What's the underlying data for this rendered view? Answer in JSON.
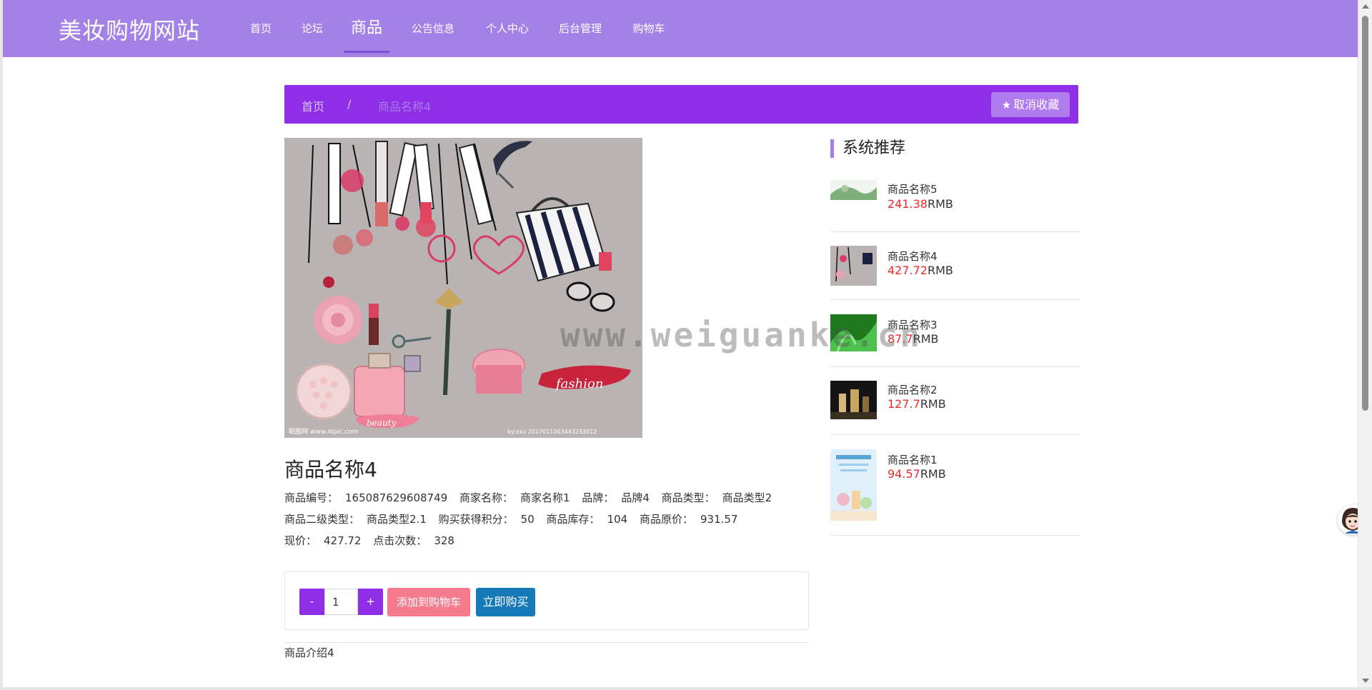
{
  "site": {
    "brand": "美妆购物网站"
  },
  "nav": {
    "items": [
      {
        "label": "首页"
      },
      {
        "label": "论坛"
      },
      {
        "label": "商品"
      },
      {
        "label": "公告信息"
      },
      {
        "label": "个人中心"
      },
      {
        "label": "后台管理"
      },
      {
        "label": "购物车"
      }
    ],
    "active": "商品"
  },
  "breadcrumb": {
    "home": "首页",
    "separator": "/",
    "current": "商品名称4",
    "favorite_button": "取消收藏",
    "favorite_icon": "star-icon"
  },
  "product": {
    "title": "商品名称4",
    "info": [
      [
        {
          "label": "商品编号：",
          "value": "165087629608749"
        },
        {
          "label": "商家名称：",
          "value": "商家名称1"
        },
        {
          "label": "品牌：",
          "value": "品牌4"
        },
        {
          "label": "商品类型：",
          "value": "商品类型2"
        }
      ],
      [
        {
          "label": "商品二级类型：",
          "value": "商品类型2.1"
        },
        {
          "label": "购买获得积分：",
          "value": "50"
        },
        {
          "label": "商品库存：",
          "value": "104"
        },
        {
          "label": "商品原价：",
          "value": "931.57"
        }
      ],
      [
        {
          "label": "现价：",
          "value": "427.72"
        },
        {
          "label": "点击次数：",
          "value": "328"
        }
      ]
    ],
    "image_watermark_left": "昵图网 www.nipic.com",
    "image_watermark_right": "by:xxx 2017011003443233012",
    "image_brand_text": "fashion",
    "image_beauty_text": "beauty",
    "quantity": "1",
    "minus_label": "-",
    "plus_label": "+",
    "add_to_cart": "添加到购物车",
    "buy_now": "立即购买",
    "intro": "商品介绍4"
  },
  "recommend": {
    "title": "系统推荐",
    "currency": "RMB",
    "items": [
      {
        "name": "商品名称5",
        "price": "241.38"
      },
      {
        "name": "商品名称4",
        "price": "427.72"
      },
      {
        "name": "商品名称3",
        "price": "87.7"
      },
      {
        "name": "商品名称2",
        "price": "127.7"
      },
      {
        "name": "商品名称1",
        "price": "94.57"
      }
    ]
  },
  "watermark": "www.weiguanke.cn",
  "colors": {
    "nav_bg": "#a381e6",
    "breadcrumb_bg": "#8e2ee6",
    "price_red": "#ef2929",
    "add_cart": "#f47a8c",
    "buy_now": "#1679b8"
  }
}
